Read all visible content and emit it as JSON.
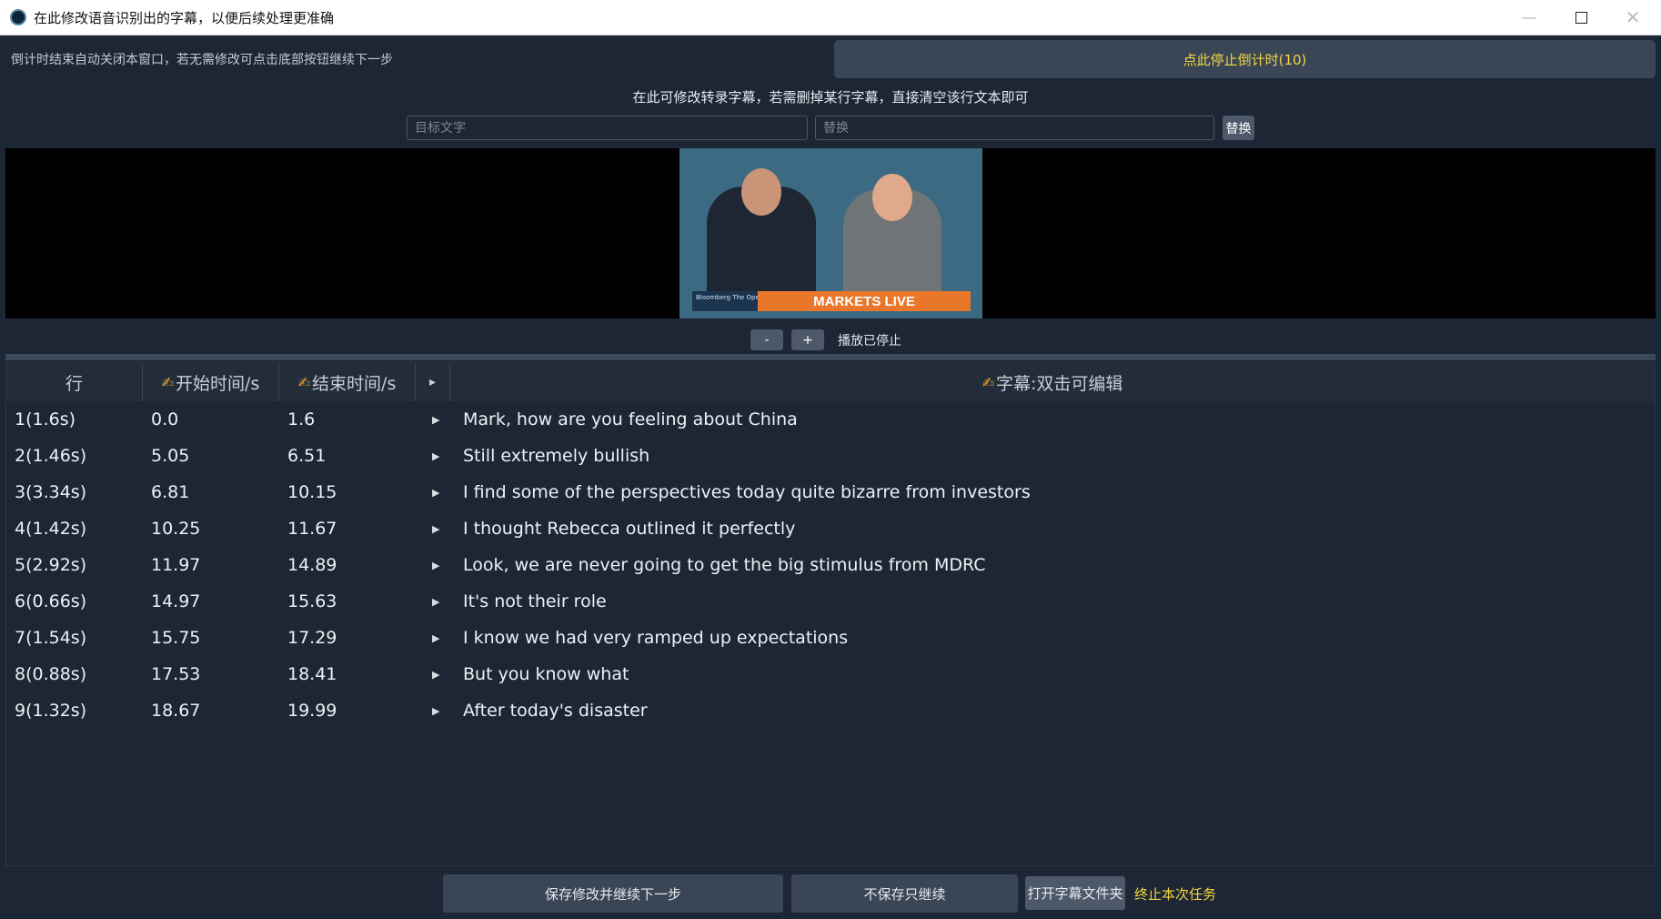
{
  "window": {
    "title": "在此修改语音识别出的字幕，以便后续处理更准确"
  },
  "top": {
    "countdown_hint": "倒计时结束自动关闭本窗口，若无需修改可点击底部按钮继续下一步",
    "stop_countdown_button": "点此停止倒计时(10)",
    "edit_hint": "在此可修改转录字幕，若需删掉某行字幕，直接清空该行文本即可"
  },
  "replace_bar": {
    "target_placeholder": "目标文字",
    "replace_placeholder": "替换",
    "replace_button": "替换"
  },
  "video": {
    "ticker_text": "MARKETS LIVE",
    "ticker_show": "Bloomberg The Opening Trade"
  },
  "playback": {
    "minus_label": "-",
    "plus_label": "+",
    "status": "播放已停止"
  },
  "table": {
    "headers": {
      "row": "行",
      "start": "开始时间/s",
      "end": "结束时间/s",
      "play": "▸",
      "subtitle": "字幕:双击可编辑"
    },
    "rows": [
      {
        "row": "1(1.6s)",
        "start": "0.0",
        "end": "1.6",
        "text": "Mark, how are you feeling about China"
      },
      {
        "row": "2(1.46s)",
        "start": "5.05",
        "end": "6.51",
        "text": "Still extremely bullish"
      },
      {
        "row": "3(3.34s)",
        "start": "6.81",
        "end": "10.15",
        "text": "I find some of the perspectives today quite bizarre from investors"
      },
      {
        "row": "4(1.42s)",
        "start": "10.25",
        "end": "11.67",
        "text": "I thought Rebecca outlined it perfectly"
      },
      {
        "row": "5(2.92s)",
        "start": "11.97",
        "end": "14.89",
        "text": "Look, we are never going to get the big stimulus from MDRC"
      },
      {
        "row": "6(0.66s)",
        "start": "14.97",
        "end": "15.63",
        "text": "It's not their role"
      },
      {
        "row": "7(1.54s)",
        "start": "15.75",
        "end": "17.29",
        "text": "I know we had very ramped up expectations"
      },
      {
        "row": "8(0.88s)",
        "start": "17.53",
        "end": "18.41",
        "text": "But you know what"
      },
      {
        "row": "9(1.32s)",
        "start": "18.67",
        "end": "19.99",
        "text": "After today's disaster"
      }
    ]
  },
  "footer": {
    "save_continue": "保存修改并继续下一步",
    "no_save_continue": "不保存只继续",
    "open_folder": "打开字幕文件夹",
    "end_task": "终止本次任务"
  }
}
